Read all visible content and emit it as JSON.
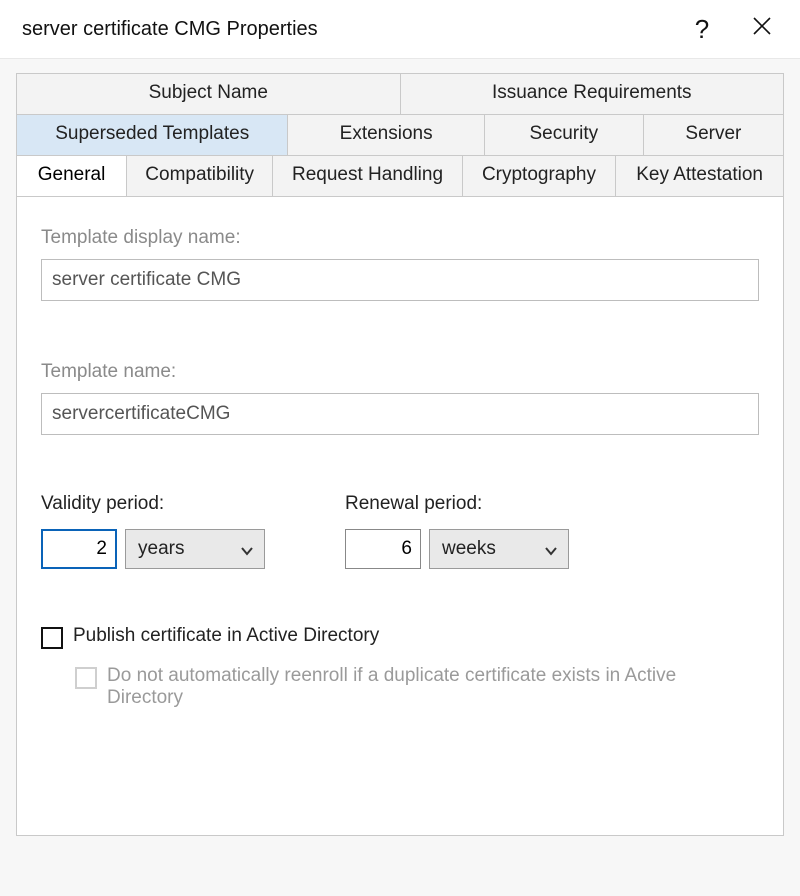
{
  "window": {
    "title": "server certificate CMG Properties",
    "help_label": "?",
    "close_label": "Close"
  },
  "tabs": {
    "row1": {
      "subject_name": "Subject Name",
      "issuance_requirements": "Issuance Requirements"
    },
    "row2": {
      "superseded_templates": "Superseded Templates",
      "extensions": "Extensions",
      "security": "Security",
      "server": "Server"
    },
    "row3": {
      "general": "General",
      "compatibility": "Compatibility",
      "request_handling": "Request Handling",
      "cryptography": "Cryptography",
      "key_attestation": "Key Attestation"
    },
    "active": "General",
    "highlighted": "Superseded Templates"
  },
  "general": {
    "template_display_name_label": "Template display name:",
    "template_display_name_value": "server certificate CMG",
    "template_name_label": "Template name:",
    "template_name_value": "servercertificateCMG",
    "validity_period_label": "Validity period:",
    "validity_period_value": "2",
    "validity_period_unit": "years",
    "renewal_period_label": "Renewal period:",
    "renewal_period_value": "6",
    "renewal_period_unit": "weeks",
    "publish_ad_label": "Publish certificate in Active Directory",
    "publish_ad_checked": false,
    "no_auto_reenroll_label": "Do not automatically reenroll if a duplicate certificate exists in Active Directory",
    "no_auto_reenroll_checked": false,
    "no_auto_reenroll_enabled": false
  }
}
